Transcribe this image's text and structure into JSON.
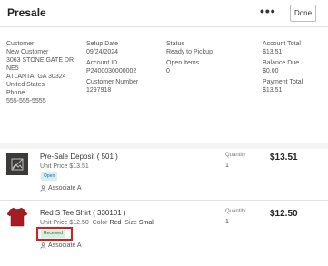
{
  "header": {
    "title": "Presale",
    "more_label": "•••",
    "done_label": "Done"
  },
  "summary": {
    "customer": {
      "label": "Customer",
      "name": "New Customer",
      "address1": "3063 STONE GATE DR",
      "address2": "NE5",
      "city": "ATLANTA, GA 30324",
      "country": "United States",
      "phone_label": "Phone",
      "phone": "555-555-5555"
    },
    "setup": {
      "label": "Setup Date",
      "value": "09/24/2024",
      "account_label": "Account ID",
      "account": "P2400030000002",
      "custnum_label": "Customer Number",
      "custnum": "1297918"
    },
    "status": {
      "label": "Status",
      "value": "Ready to Pickup",
      "open_label": "Open Items",
      "open": "0"
    },
    "totals": {
      "account_label": "Account Total",
      "account": "$13.51",
      "balance_label": "Balance Due",
      "balance": "$0.00",
      "payment_label": "Payment Total",
      "payment": "$13.51"
    }
  },
  "items": [
    {
      "name": "Pre-Sale Deposit ( 501 )",
      "unit_price_label": "Unit Price",
      "unit_price": "$13.51",
      "badge": "Open",
      "associate": "Associate A",
      "qty_label": "Quantity",
      "qty": "1",
      "price": "$13.51",
      "thumb_icon": "no-image-icon"
    },
    {
      "name": "Red S Tee Shirt ( 330101 )",
      "unit_price_label": "Unit Price",
      "unit_price": "$12.50",
      "color_label": "Color",
      "color": "Red",
      "size_label": "Size",
      "size": "Small",
      "badge": "Received",
      "associate": "Associate A",
      "qty_label": "Quantity",
      "qty": "1",
      "price": "$12.50",
      "thumb_icon": "tshirt-icon"
    }
  ],
  "colors": {
    "highlight": "#d61f1f",
    "open_badge": "#d6ecf7",
    "received_badge": "#d8eddf",
    "shirt": "#a51b22"
  }
}
